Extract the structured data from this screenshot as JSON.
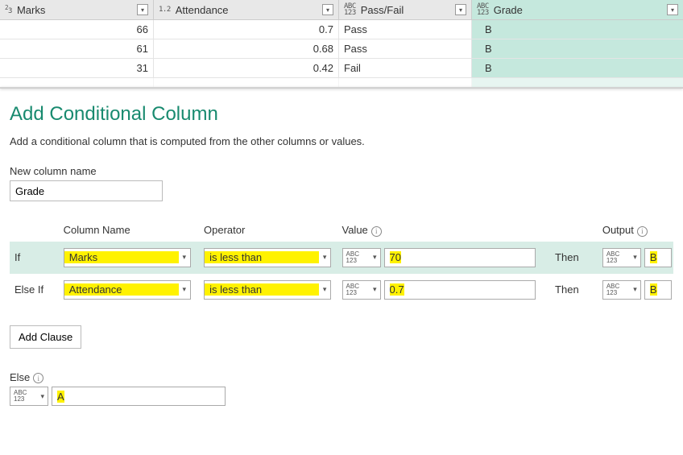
{
  "grid": {
    "cols": [
      {
        "name": "Marks",
        "type": "23"
      },
      {
        "name": "Attendance",
        "type": "1.2"
      },
      {
        "name": "Pass/Fail",
        "type": "abc123"
      },
      {
        "name": "Grade",
        "type": "abc123"
      }
    ],
    "rows": [
      {
        "marks": "66",
        "att": "0.7",
        "pf": "Pass",
        "grade": "B"
      },
      {
        "marks": "61",
        "att": "0.68",
        "pf": "Pass",
        "grade": "B"
      },
      {
        "marks": "31",
        "att": "0.42",
        "pf": "Fail",
        "grade": "B"
      }
    ]
  },
  "dialog": {
    "title": "Add Conditional Column",
    "subtitle": "Add a conditional column that is computed from the other columns or values.",
    "newcol_label": "New column name",
    "newcol_value": "Grade",
    "headers": {
      "col": "Column Name",
      "op": "Operator",
      "val": "Value",
      "out": "Output"
    },
    "rules": [
      {
        "label": "If",
        "col": "Marks",
        "op": "is less than",
        "val": "70",
        "then": "Then",
        "out": "B"
      },
      {
        "label": "Else If",
        "col": "Attendance",
        "op": "is less than",
        "val": "0.7",
        "then": "Then",
        "out": "B"
      }
    ],
    "add_clause": "Add Clause",
    "else_label": "Else",
    "else_value": "A"
  }
}
